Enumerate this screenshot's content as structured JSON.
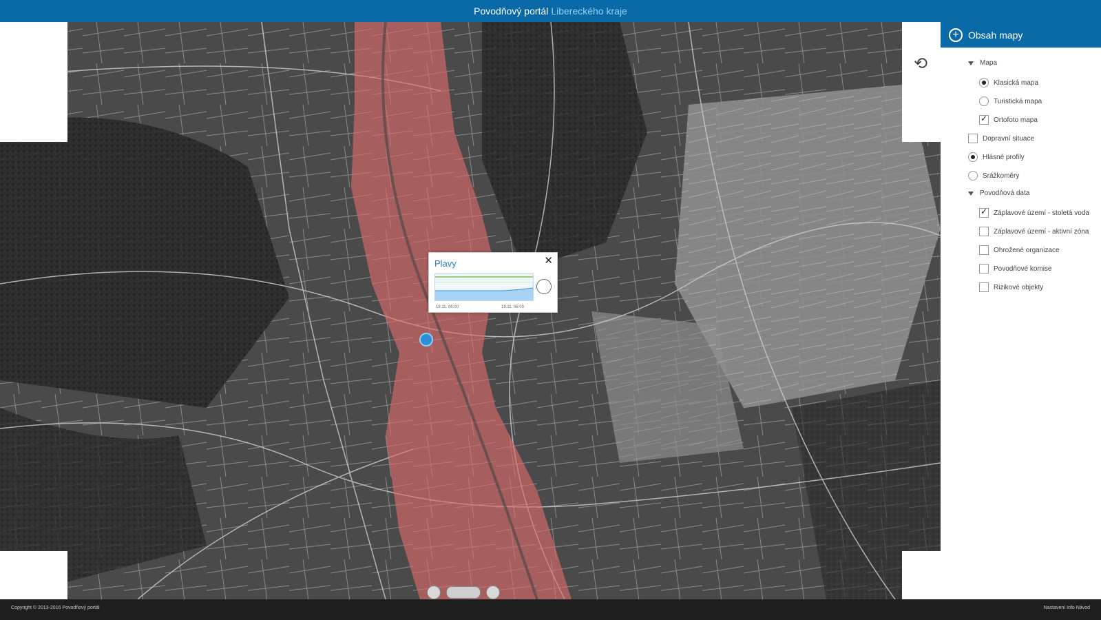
{
  "header": {
    "title_main": "Povodňový portál",
    "title_accent": "Libereckého kraje"
  },
  "popup": {
    "title": "Plavy",
    "close_glyph": "✕",
    "time_start": "18.11. 06:00",
    "time_end": "19.11. 06:00"
  },
  "panel": {
    "title": "Obsah mapy",
    "items": [
      {
        "kind": "group",
        "label": "Mapa",
        "expanded": true
      },
      {
        "kind": "radio",
        "label": "Klasická mapa",
        "checked": true
      },
      {
        "kind": "radio",
        "label": "Turistická mapa",
        "checked": false
      },
      {
        "kind": "checkbox",
        "label": "Ortofoto mapa",
        "checked": true
      },
      {
        "kind": "checkbox",
        "label": "Dopravní situace",
        "checked": false
      },
      {
        "kind": "radio",
        "label": "Hlásné profily",
        "checked": true
      },
      {
        "kind": "radio",
        "label": "Srážkoměry",
        "checked": false
      },
      {
        "kind": "group",
        "label": "Povodňová data",
        "expanded": true
      },
      {
        "kind": "checkbox",
        "label": "Záplavové území - stoletá voda",
        "checked": true
      },
      {
        "kind": "checkbox",
        "label": "Záplavové území - aktivní zóna",
        "checked": false
      },
      {
        "kind": "checkbox",
        "label": "Ohrožené organizace",
        "checked": false
      },
      {
        "kind": "checkbox",
        "label": "Povodňové komise",
        "checked": false
      },
      {
        "kind": "checkbox",
        "label": "Rizikové objekty",
        "checked": false
      }
    ]
  },
  "footer": {
    "copyright": "Copyright © 2013-2016 Povodňový portál",
    "right_text": "Nastavení Info Návod"
  },
  "colors": {
    "header_blue": "#0a6aa8",
    "flood_zone": "#e06a6a",
    "marker": "#2b8fd4"
  },
  "icons": {
    "history": "history-icon",
    "add": "plus-circle-icon"
  }
}
